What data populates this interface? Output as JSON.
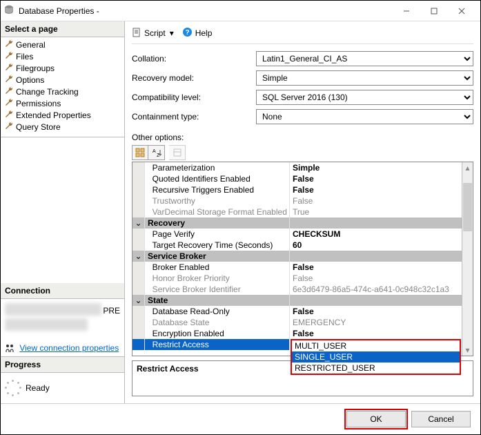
{
  "window": {
    "title": "Database Properties -"
  },
  "sidebar": {
    "section_pages": "Select a page",
    "items": [
      "General",
      "Files",
      "Filegroups",
      "Options",
      "Change Tracking",
      "Permissions",
      "Extended Properties",
      "Query Store"
    ],
    "section_conn": "Connection",
    "conn_server_suffix": "PRE",
    "view_conn_props": "View connection properties",
    "section_progress": "Progress",
    "progress_state": "Ready"
  },
  "toolbar": {
    "script": "Script",
    "help": "Help"
  },
  "form": {
    "collation_label": "Collation:",
    "collation_value": "Latin1_General_CI_AS",
    "recovery_label": "Recovery model:",
    "recovery_value": "Simple",
    "compat_label": "Compatibility level:",
    "compat_value": "SQL Server 2016 (130)",
    "contain_label": "Containment type:",
    "contain_value": "None",
    "other_label": "Other options:"
  },
  "grid": {
    "rows": [
      {
        "k": "Parameterization",
        "v": "Simple",
        "bold": true
      },
      {
        "k": "Quoted Identifiers Enabled",
        "v": "False",
        "bold": true
      },
      {
        "k": "Recursive Triggers Enabled",
        "v": "False",
        "bold": true
      },
      {
        "k": "Trustworthy",
        "v": "False",
        "ro": true
      },
      {
        "k": "VarDecimal Storage Format Enabled",
        "v": "True",
        "ro": true
      },
      {
        "group": "Recovery"
      },
      {
        "k": "Page Verify",
        "v": "CHECKSUM",
        "bold": true
      },
      {
        "k": "Target Recovery Time (Seconds)",
        "v": "60",
        "bold": true
      },
      {
        "group": "Service Broker"
      },
      {
        "k": "Broker Enabled",
        "v": "False",
        "bold": true
      },
      {
        "k": "Honor Broker Priority",
        "v": "False",
        "ro": true
      },
      {
        "k": "Service Broker Identifier",
        "v": "6e3d6479-86a5-474c-a641-0c948c32c1a3",
        "ro": true
      },
      {
        "group": "State"
      },
      {
        "k": "Database Read-Only",
        "v": "False",
        "bold": true
      },
      {
        "k": "Database State",
        "v": "EMERGENCY",
        "ro": true
      },
      {
        "k": "Encryption Enabled",
        "v": "False",
        "bold": true
      },
      {
        "k": "Restrict Access",
        "v": "SINGLE_USER",
        "sel": true,
        "bold": true
      }
    ],
    "dropdown": [
      "MULTI_USER",
      "SINGLE_USER",
      "RESTRICTED_USER"
    ],
    "dropdown_selected": "SINGLE_USER",
    "help_label": "Restrict Access"
  },
  "buttons": {
    "ok": "OK",
    "cancel": "Cancel"
  }
}
